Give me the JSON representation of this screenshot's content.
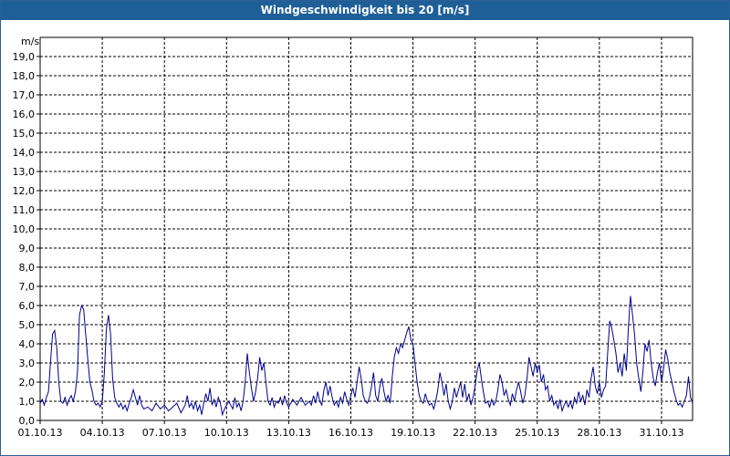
{
  "window": {
    "title": "Windgeschwindigkeit bis 20 [m/s]"
  },
  "colors": {
    "titlebar": "#1f5f98",
    "series": "#00008b",
    "grid": "#000000"
  },
  "chart_data": {
    "type": "line",
    "title": "Windgeschwindigkeit bis 20 [m/s]",
    "ylabel": "m/s",
    "xlabel": "",
    "ylim": [
      0,
      20
    ],
    "xlim_days": [
      0,
      31.5
    ],
    "grid": true,
    "legend": "none",
    "y_ticks": [
      "0,0",
      "1,0",
      "2,0",
      "3,0",
      "4,0",
      "5,0",
      "6,0",
      "7,0",
      "8,0",
      "9,0",
      "10,0",
      "11,0",
      "12,0",
      "13,0",
      "14,0",
      "15,0",
      "16,0",
      "17,0",
      "18,0",
      "19,0"
    ],
    "x_ticks": [
      "01.10.13",
      "04.10.13",
      "07.10.13",
      "10.10.13",
      "13.10.13",
      "16.10.13",
      "19.10.13",
      "22.10.13",
      "25.10.13",
      "28.10.13",
      "31.10.13"
    ],
    "series": [
      {
        "values": [
          [
            0.0,
            0.9
          ],
          [
            0.1,
            1.1
          ],
          [
            0.2,
            0.8
          ],
          [
            0.3,
            1.2
          ],
          [
            0.4,
            1.5
          ],
          [
            0.5,
            3.0
          ],
          [
            0.6,
            4.5
          ],
          [
            0.7,
            4.7
          ],
          [
            0.8,
            3.8
          ],
          [
            0.9,
            2.0
          ],
          [
            1.0,
            1.0
          ],
          [
            1.1,
            0.9
          ],
          [
            1.2,
            1.2
          ],
          [
            1.3,
            0.8
          ],
          [
            1.4,
            1.1
          ],
          [
            1.5,
            1.3
          ],
          [
            1.6,
            1.0
          ],
          [
            1.7,
            1.5
          ],
          [
            1.8,
            2.5
          ],
          [
            1.9,
            5.5
          ],
          [
            2.0,
            6.0
          ],
          [
            2.1,
            5.8
          ],
          [
            2.2,
            4.5
          ],
          [
            2.3,
            3.2
          ],
          [
            2.4,
            2.0
          ],
          [
            2.5,
            1.6
          ],
          [
            2.6,
            1.0
          ],
          [
            2.7,
            0.8
          ],
          [
            2.8,
            0.9
          ],
          [
            2.9,
            0.7
          ],
          [
            3.0,
            1.0
          ],
          [
            3.1,
            2.5
          ],
          [
            3.2,
            4.8
          ],
          [
            3.3,
            5.5
          ],
          [
            3.4,
            4.5
          ],
          [
            3.5,
            2.2
          ],
          [
            3.6,
            1.2
          ],
          [
            3.7,
            0.9
          ],
          [
            3.8,
            0.7
          ],
          [
            3.9,
            0.9
          ],
          [
            4.0,
            0.6
          ],
          [
            4.1,
            0.8
          ],
          [
            4.2,
            0.5
          ],
          [
            4.3,
            0.9
          ],
          [
            4.4,
            1.2
          ],
          [
            4.5,
            1.6
          ],
          [
            4.6,
            1.2
          ],
          [
            4.7,
            0.8
          ],
          [
            4.8,
            1.3
          ],
          [
            4.9,
            0.8
          ],
          [
            5.0,
            0.6
          ],
          [
            5.2,
            0.7
          ],
          [
            5.4,
            0.5
          ],
          [
            5.6,
            0.9
          ],
          [
            5.8,
            0.6
          ],
          [
            6.0,
            0.8
          ],
          [
            6.2,
            0.5
          ],
          [
            6.4,
            0.7
          ],
          [
            6.6,
            0.9
          ],
          [
            6.8,
            0.4
          ],
          [
            7.0,
            0.8
          ],
          [
            7.1,
            1.3
          ],
          [
            7.2,
            0.7
          ],
          [
            7.3,
            0.9
          ],
          [
            7.4,
            0.6
          ],
          [
            7.5,
            1.0
          ],
          [
            7.6,
            0.5
          ],
          [
            7.7,
            0.8
          ],
          [
            7.8,
            0.3
          ],
          [
            7.9,
            0.9
          ],
          [
            8.0,
            1.4
          ],
          [
            8.1,
            1.0
          ],
          [
            8.2,
            1.7
          ],
          [
            8.3,
            0.8
          ],
          [
            8.4,
            1.1
          ],
          [
            8.5,
            0.7
          ],
          [
            8.6,
            1.2
          ],
          [
            8.7,
            0.9
          ],
          [
            8.8,
            0.3
          ],
          [
            8.9,
            0.6
          ],
          [
            9.0,
            0.8
          ],
          [
            9.1,
            1.0
          ],
          [
            9.2,
            0.8
          ],
          [
            9.3,
            0.6
          ],
          [
            9.4,
            1.2
          ],
          [
            9.5,
            0.7
          ],
          [
            9.6,
            0.9
          ],
          [
            9.7,
            0.5
          ],
          [
            9.8,
            1.0
          ],
          [
            9.9,
            2.0
          ],
          [
            10.0,
            3.5
          ],
          [
            10.1,
            2.5
          ],
          [
            10.2,
            1.7
          ],
          [
            10.3,
            1.0
          ],
          [
            10.4,
            1.5
          ],
          [
            10.5,
            2.2
          ],
          [
            10.6,
            3.3
          ],
          [
            10.7,
            2.6
          ],
          [
            10.8,
            3.0
          ],
          [
            10.9,
            2.0
          ],
          [
            11.0,
            1.0
          ],
          [
            11.1,
            0.8
          ],
          [
            11.2,
            1.2
          ],
          [
            11.3,
            0.7
          ],
          [
            11.4,
            1.0
          ],
          [
            11.5,
            0.9
          ],
          [
            11.6,
            1.2
          ],
          [
            11.7,
            0.8
          ],
          [
            11.8,
            1.3
          ],
          [
            11.9,
            0.9
          ],
          [
            12.0,
            0.7
          ],
          [
            12.2,
            1.1
          ],
          [
            12.4,
            0.8
          ],
          [
            12.6,
            1.2
          ],
          [
            12.8,
            0.8
          ],
          [
            13.0,
            1.0
          ],
          [
            13.1,
            0.8
          ],
          [
            13.2,
            1.3
          ],
          [
            13.3,
            0.9
          ],
          [
            13.4,
            1.5
          ],
          [
            13.5,
            1.0
          ],
          [
            13.6,
            0.8
          ],
          [
            13.7,
            1.6
          ],
          [
            13.8,
            2.0
          ],
          [
            13.9,
            1.3
          ],
          [
            14.0,
            1.8
          ],
          [
            14.1,
            1.2
          ],
          [
            14.2,
            0.8
          ],
          [
            14.3,
            1.0
          ],
          [
            14.4,
            0.7
          ],
          [
            14.5,
            1.2
          ],
          [
            14.6,
            0.9
          ],
          [
            14.7,
            1.5
          ],
          [
            14.8,
            1.1
          ],
          [
            14.9,
            0.8
          ],
          [
            15.0,
            1.3
          ],
          [
            15.1,
            1.7
          ],
          [
            15.2,
            1.2
          ],
          [
            15.3,
            2.0
          ],
          [
            15.4,
            2.8
          ],
          [
            15.5,
            2.2
          ],
          [
            15.6,
            1.3
          ],
          [
            15.7,
            1.0
          ],
          [
            15.8,
            0.9
          ],
          [
            15.9,
            1.2
          ],
          [
            16.0,
            1.8
          ],
          [
            16.1,
            2.5
          ],
          [
            16.2,
            1.3
          ],
          [
            16.3,
            1.0
          ],
          [
            16.4,
            1.8
          ],
          [
            16.5,
            2.2
          ],
          [
            16.6,
            1.5
          ],
          [
            16.7,
            1.0
          ],
          [
            16.8,
            1.3
          ],
          [
            16.9,
            0.9
          ],
          [
            17.0,
            2.3
          ],
          [
            17.1,
            3.3
          ],
          [
            17.2,
            3.8
          ],
          [
            17.3,
            3.5
          ],
          [
            17.4,
            4.0
          ],
          [
            17.5,
            3.8
          ],
          [
            17.6,
            4.2
          ],
          [
            17.7,
            4.6
          ],
          [
            17.8,
            4.9
          ],
          [
            17.9,
            4.2
          ],
          [
            18.0,
            4.0
          ],
          [
            18.1,
            3.0
          ],
          [
            18.2,
            2.0
          ],
          [
            18.3,
            1.3
          ],
          [
            18.4,
            1.0
          ],
          [
            18.5,
            0.9
          ],
          [
            18.6,
            1.4
          ],
          [
            18.7,
            1.0
          ],
          [
            18.8,
            0.8
          ],
          [
            18.9,
            0.9
          ],
          [
            19.0,
            0.6
          ],
          [
            19.1,
            1.0
          ],
          [
            19.2,
            1.6
          ],
          [
            19.3,
            2.5
          ],
          [
            19.4,
            2.0
          ],
          [
            19.5,
            1.3
          ],
          [
            19.6,
            1.9
          ],
          [
            19.7,
            1.0
          ],
          [
            19.8,
            0.6
          ],
          [
            19.9,
            1.0
          ],
          [
            20.0,
            1.7
          ],
          [
            20.1,
            1.2
          ],
          [
            20.2,
            1.6
          ],
          [
            20.3,
            2.0
          ],
          [
            20.4,
            1.2
          ],
          [
            20.5,
            1.9
          ],
          [
            20.6,
            1.0
          ],
          [
            20.7,
            1.4
          ],
          [
            20.8,
            0.8
          ],
          [
            20.9,
            1.2
          ],
          [
            21.0,
            1.8
          ],
          [
            21.1,
            2.6
          ],
          [
            21.2,
            3.0
          ],
          [
            21.3,
            2.2
          ],
          [
            21.4,
            1.5
          ],
          [
            21.5,
            0.9
          ],
          [
            21.6,
            1.0
          ],
          [
            21.7,
            0.7
          ],
          [
            21.8,
            1.1
          ],
          [
            21.9,
            0.8
          ],
          [
            22.0,
            1.0
          ],
          [
            22.1,
            1.6
          ],
          [
            22.2,
            2.4
          ],
          [
            22.3,
            2.0
          ],
          [
            22.4,
            1.3
          ],
          [
            22.5,
            1.6
          ],
          [
            22.6,
            1.1
          ],
          [
            22.7,
            0.8
          ],
          [
            22.8,
            1.4
          ],
          [
            22.9,
            1.0
          ],
          [
            23.0,
            1.6
          ],
          [
            23.1,
            2.0
          ],
          [
            23.2,
            1.5
          ],
          [
            23.3,
            0.9
          ],
          [
            23.4,
            1.3
          ],
          [
            23.5,
            2.1
          ],
          [
            23.6,
            3.3
          ],
          [
            23.7,
            2.8
          ],
          [
            23.8,
            2.3
          ],
          [
            23.9,
            3.0
          ],
          [
            24.0,
            2.5
          ],
          [
            24.1,
            2.9
          ],
          [
            24.2,
            2.0
          ],
          [
            24.3,
            2.4
          ],
          [
            24.4,
            1.6
          ],
          [
            24.5,
            1.8
          ],
          [
            24.6,
            1.0
          ],
          [
            24.7,
            1.3
          ],
          [
            24.8,
            0.8
          ],
          [
            24.9,
            1.0
          ],
          [
            25.0,
            0.6
          ],
          [
            25.1,
            1.1
          ],
          [
            25.2,
            0.5
          ],
          [
            25.3,
            0.8
          ],
          [
            25.4,
            1.0
          ],
          [
            25.5,
            0.7
          ],
          [
            25.6,
            1.0
          ],
          [
            25.7,
            0.6
          ],
          [
            25.8,
            1.2
          ],
          [
            25.9,
            0.9
          ],
          [
            26.0,
            1.5
          ],
          [
            26.1,
            1.0
          ],
          [
            26.2,
            1.3
          ],
          [
            26.3,
            0.8
          ],
          [
            26.4,
            1.6
          ],
          [
            26.5,
            1.2
          ],
          [
            26.6,
            2.2
          ],
          [
            26.7,
            2.8
          ],
          [
            26.8,
            1.8
          ],
          [
            26.9,
            1.4
          ],
          [
            27.0,
            2.0
          ],
          [
            27.1,
            1.2
          ],
          [
            27.2,
            1.6
          ],
          [
            27.3,
            1.8
          ],
          [
            27.4,
            3.5
          ],
          [
            27.5,
            5.2
          ],
          [
            27.6,
            4.8
          ],
          [
            27.7,
            4.2
          ],
          [
            27.8,
            3.5
          ],
          [
            27.9,
            2.5
          ],
          [
            28.0,
            3.0
          ],
          [
            28.1,
            2.3
          ],
          [
            28.2,
            3.5
          ],
          [
            28.3,
            2.6
          ],
          [
            28.4,
            4.8
          ],
          [
            28.5,
            6.5
          ],
          [
            28.6,
            5.5
          ],
          [
            28.7,
            4.5
          ],
          [
            28.8,
            3.0
          ],
          [
            28.9,
            2.2
          ],
          [
            29.0,
            1.5
          ],
          [
            29.1,
            2.5
          ],
          [
            29.2,
            4.0
          ],
          [
            29.3,
            3.6
          ],
          [
            29.4,
            4.2
          ],
          [
            29.5,
            3.0
          ],
          [
            29.6,
            2.2
          ],
          [
            29.7,
            1.8
          ],
          [
            29.8,
            2.5
          ],
          [
            29.9,
            3.0
          ],
          [
            30.0,
            2.0
          ],
          [
            30.1,
            2.7
          ],
          [
            30.2,
            3.7
          ],
          [
            30.3,
            3.2
          ],
          [
            30.4,
            2.5
          ],
          [
            30.5,
            2.0
          ],
          [
            30.6,
            1.5
          ],
          [
            30.7,
            1.1
          ],
          [
            30.8,
            0.8
          ],
          [
            30.9,
            0.9
          ],
          [
            31.0,
            0.7
          ],
          [
            31.1,
            1.0
          ],
          [
            31.2,
            1.3
          ],
          [
            31.3,
            2.3
          ],
          [
            31.4,
            1.2
          ],
          [
            31.5,
            0.9
          ]
        ]
      }
    ]
  }
}
